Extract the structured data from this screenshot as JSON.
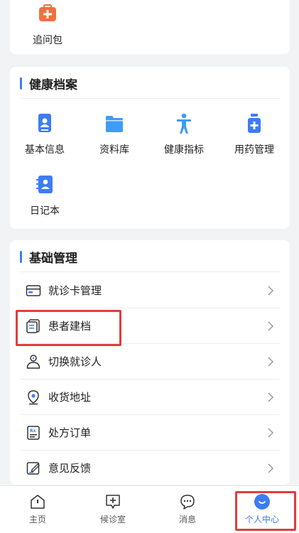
{
  "top_card": {
    "item_label": "追问包"
  },
  "health": {
    "title": "健康档案",
    "items": [
      {
        "label": "基本信息",
        "icon": "id-card-icon"
      },
      {
        "label": "资料库",
        "icon": "folder-icon"
      },
      {
        "label": "健康指标",
        "icon": "person-body-icon"
      },
      {
        "label": "用药管理",
        "icon": "medicine-bottle-icon"
      },
      {
        "label": "日记本",
        "icon": "diary-icon"
      }
    ]
  },
  "basic": {
    "title": "基础管理",
    "rows": [
      {
        "label": "就诊卡管理",
        "icon": "card-icon"
      },
      {
        "label": "患者建档",
        "icon": "document-icon"
      },
      {
        "label": "切换就诊人",
        "icon": "user-icon"
      },
      {
        "label": "收货地址",
        "icon": "location-icon"
      },
      {
        "label": "处方订单",
        "icon": "prescription-icon"
      },
      {
        "label": "意见反馈",
        "icon": "feedback-icon"
      }
    ]
  },
  "tabbar": {
    "tabs": [
      {
        "label": "主页",
        "icon": "home-icon"
      },
      {
        "label": "候诊室",
        "icon": "waiting-room-icon"
      },
      {
        "label": "消息",
        "icon": "message-icon"
      },
      {
        "label": "个人中心",
        "icon": "profile-icon",
        "active": true
      }
    ]
  },
  "colors": {
    "accent": "#3d7cf5",
    "highlight": "#e23c3c",
    "orange": "#f1703f"
  }
}
